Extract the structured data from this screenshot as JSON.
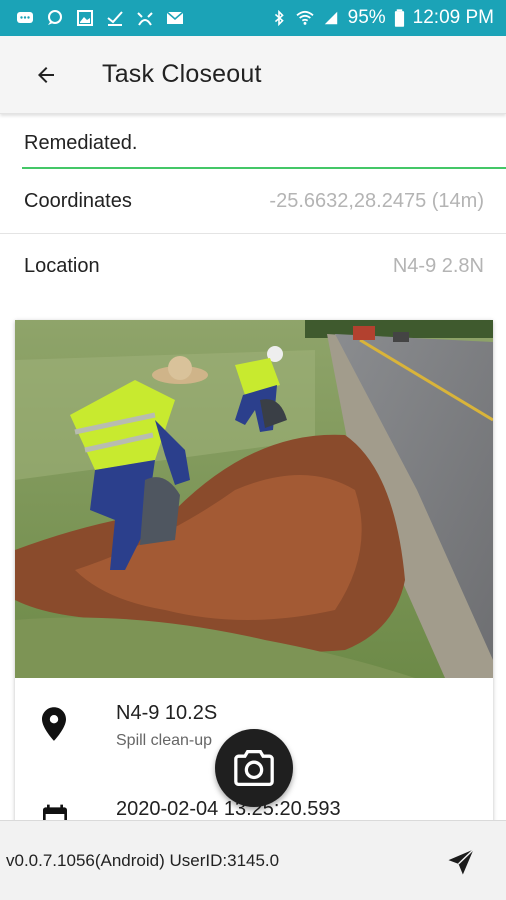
{
  "status_bar": {
    "battery": "95%",
    "time": "12:09 PM",
    "background_color": "#1ba3b7",
    "icons": [
      "message-icon",
      "chat-icon",
      "image-icon",
      "check-icon",
      "person-icon",
      "mail-icon",
      "bluetooth-icon",
      "wifi-icon",
      "signal-icon",
      "battery-icon"
    ]
  },
  "app_bar": {
    "title": "Task Closeout",
    "back_icon": "arrow-back-icon"
  },
  "form": {
    "remarks_value": "Remediated.",
    "accent_color": "#44c767",
    "coordinates": {
      "label": "Coordinates",
      "value": "-25.6632,28.2475 (14m)"
    },
    "location": {
      "label": "Location",
      "value": "N4-9 2.8N"
    }
  },
  "card": {
    "photo_description_icon": "roadside-cleanup-photo",
    "location_title": "N4-9 10.2S",
    "location_subtitle": "Spill clean-up",
    "datetime": "2020-02-04 13:25:20.593"
  },
  "fab": {
    "icon": "camera-icon"
  },
  "footer": {
    "version_text": "v0.0.7.1056(Android) UserID:3145.0",
    "send_icon": "send-icon"
  }
}
